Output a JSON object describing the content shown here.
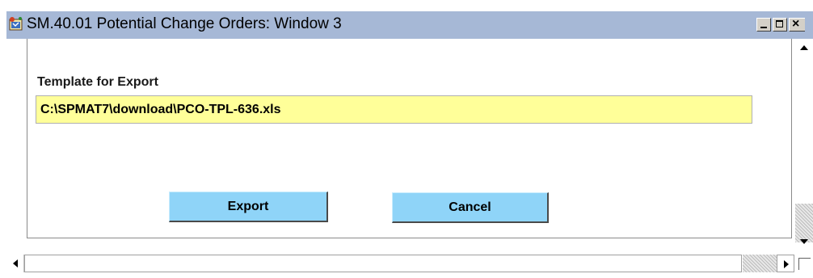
{
  "window": {
    "title": "SM.40.01 Potential Change Orders: Window 3",
    "icon": "app-window-icon",
    "controls": {
      "minimize": "minimize-icon",
      "maximize": "maximize-icon",
      "close": "×"
    }
  },
  "form": {
    "template_label": "Template for Export",
    "template_path": "C:\\SPMAT7\\download\\PCO-TPL-636.xls",
    "field_color": "#ffff99"
  },
  "buttons": {
    "export_label": "Export",
    "cancel_label": "Cancel",
    "color": "#8fd4f8"
  }
}
